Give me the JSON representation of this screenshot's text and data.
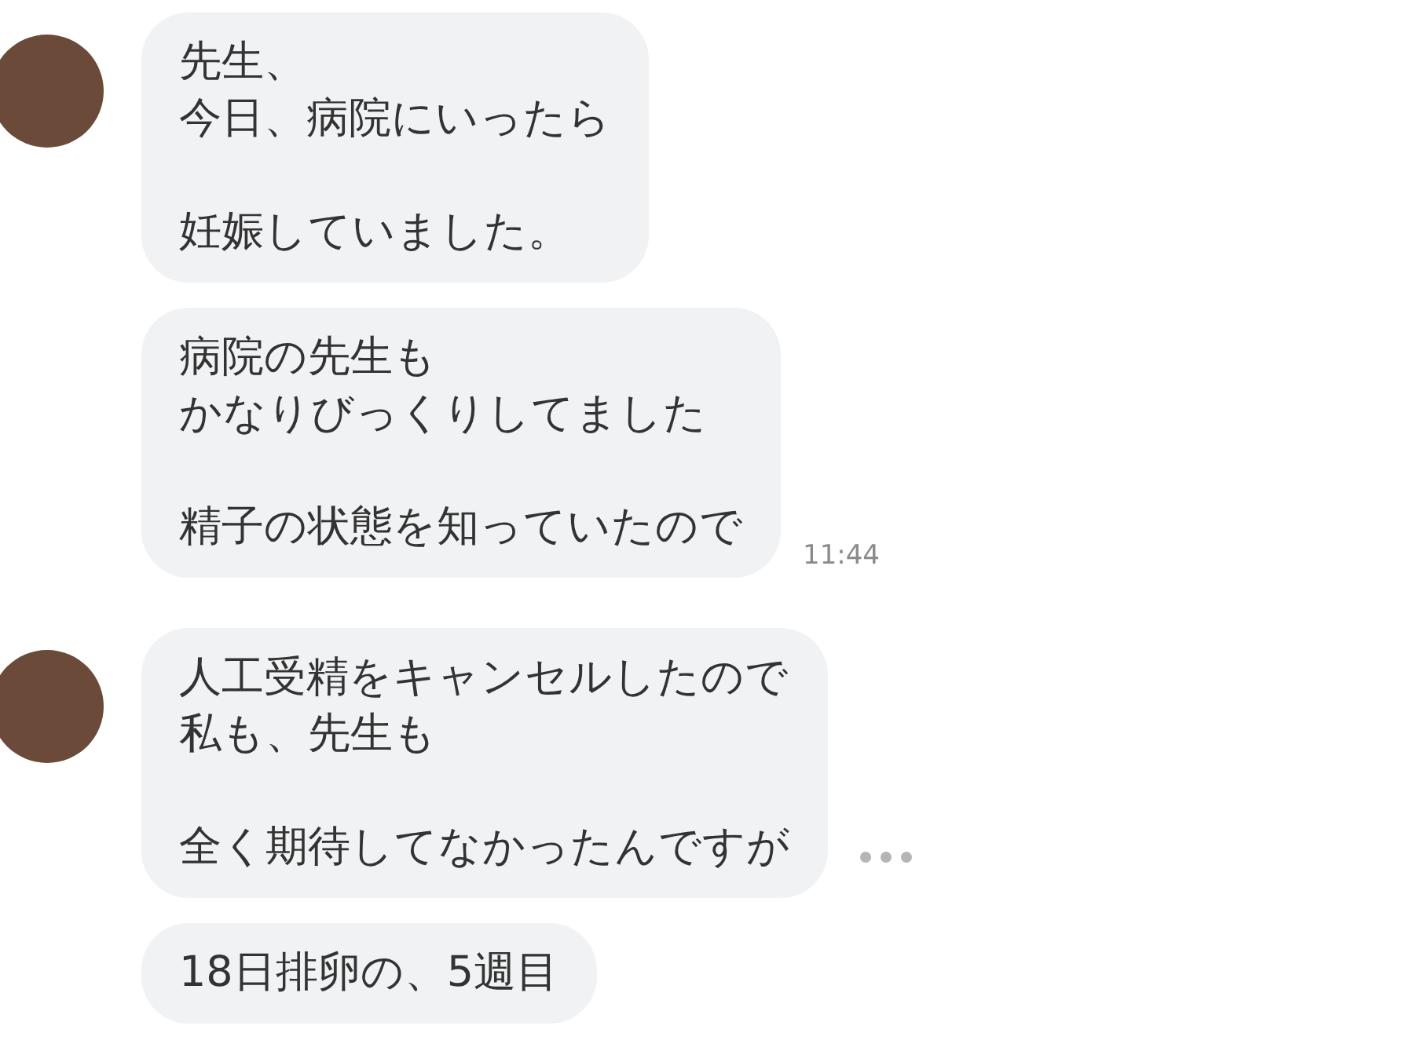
{
  "messages": [
    {
      "show_avatar": true,
      "paragraphs": [
        [
          "先生、",
          "今日、病院にいったら"
        ],
        [
          "妊娠していました。"
        ]
      ],
      "more": false
    },
    {
      "show_avatar": false,
      "paragraphs": [
        [
          "病院の先生も",
          "かなりびっくりしてました"
        ],
        [
          "精子の状態を知っていたので"
        ]
      ],
      "time": "11:44",
      "more": false
    },
    {
      "show_avatar": true,
      "paragraphs": [
        [
          "人工受精をキャンセルしたので",
          "私も、先生も"
        ],
        [
          "全く期待してなかったんですが"
        ]
      ],
      "more": true
    },
    {
      "show_avatar": false,
      "paragraphs": [
        [
          "18日排卵の、5週目"
        ]
      ],
      "more": false
    }
  ]
}
